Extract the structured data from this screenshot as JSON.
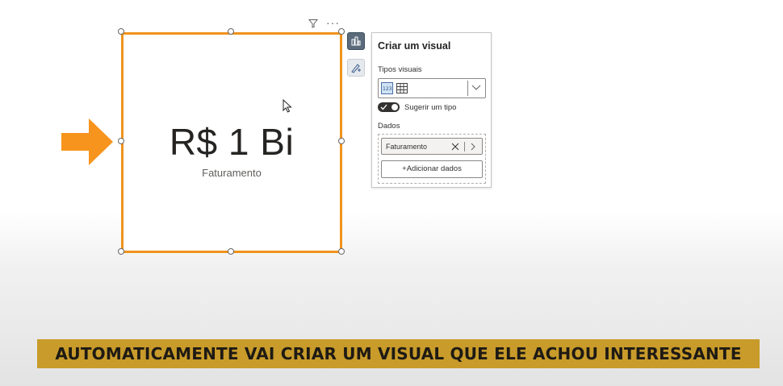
{
  "card": {
    "value": "R$ 1 Bi",
    "label": "Faturamento",
    "border_color": "#f0931c"
  },
  "header_icons": [
    "filter-icon",
    "more-options-icon"
  ],
  "side_toolbar": [
    "build-visual-icon",
    "format-visual-icon"
  ],
  "panel": {
    "title": "Criar um visual",
    "visual_types_label": "Tipos visuais",
    "visual_types": [
      "card-icon",
      "table-icon"
    ],
    "suggest_label": "Sugerir um tipo",
    "suggest_on": true,
    "data_label": "Dados",
    "field": "Faturamento",
    "add_data": "+Adicionar dados"
  },
  "arrow_color": "#f7941d",
  "caption": {
    "text": "AUTOMATICAMENTE VAI CRIAR UM VISUAL QUE ELE ACHOU INTERESSANTE",
    "background": "#c89b2a"
  }
}
